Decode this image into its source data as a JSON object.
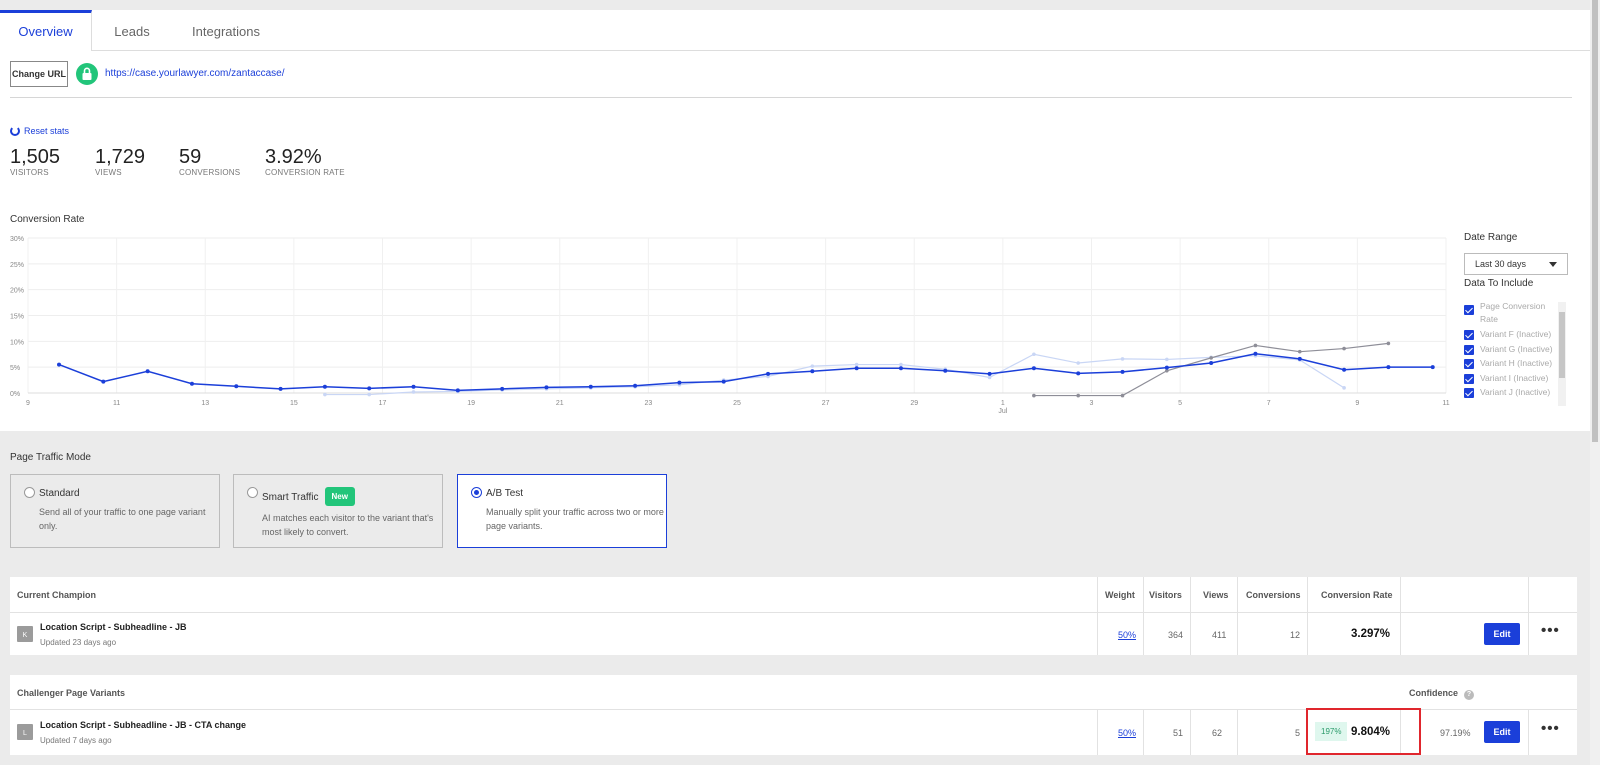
{
  "tabs": [
    {
      "label": "Overview",
      "active": true
    },
    {
      "label": "Leads",
      "active": false
    },
    {
      "label": "Integrations",
      "active": false
    }
  ],
  "url_bar": {
    "change_url_label": "Change URL",
    "url": "https://case.yourlawyer.com/zantaccase/",
    "lock_icon": "lock-icon"
  },
  "stats": {
    "reset_label": "Reset stats",
    "items": [
      {
        "value": "1,505",
        "label": "VISITORS"
      },
      {
        "value": "1,729",
        "label": "VIEWS"
      },
      {
        "value": "59",
        "label": "CONVERSIONS"
      },
      {
        "value": "3.92%",
        "label": "CONVERSION RATE"
      }
    ]
  },
  "conversion_rate_title": "Conversion Rate",
  "chart_data": {
    "type": "line",
    "title": "Conversion Rate",
    "x_ticks": [
      "9",
      "11",
      "13",
      "15",
      "17",
      "19",
      "21",
      "23",
      "25",
      "27",
      "29",
      "1",
      "3",
      "5",
      "7",
      "9",
      "11"
    ],
    "x_sublabel": {
      "tick": "1",
      "text": "Jul"
    },
    "y_ticks": [
      "30%",
      "25%",
      "20%",
      "15%",
      "10%",
      "5%",
      "0%"
    ],
    "ylim": [
      0,
      30
    ],
    "grid": true,
    "colors": {
      "main": "#1b3fd9",
      "light": "#c9d6f5",
      "gray": "#8e8e98",
      "mid": "#8c9bd6"
    },
    "series": [
      {
        "key": "main",
        "x": [
          9.7,
          10.7,
          11.7,
          12.7,
          13.7,
          14.7,
          15.7,
          16.7,
          17.7,
          18.7,
          19.7,
          20.7,
          21.7,
          22.7,
          23.7,
          24.7,
          25.7,
          26.7,
          27.7,
          28.7,
          29.7,
          30.7,
          31.7,
          32.7,
          33.7,
          34.7,
          35.7,
          36.7,
          37.7,
          38.7,
          39.7,
          40.7
        ],
        "values": [
          5.5,
          2.2,
          4.2,
          1.8,
          1.3,
          0.8,
          1.2,
          0.9,
          1.2,
          0.5,
          0.8,
          1.1,
          1.2,
          1.4,
          2.0,
          2.2,
          3.7,
          4.2,
          4.8,
          4.8,
          4.3,
          3.7,
          4.8,
          3.8,
          4.1,
          4.9,
          5.8,
          7.6,
          6.6,
          4.5,
          5.0,
          5.0
        ]
      },
      {
        "key": "light",
        "x": [
          15.7,
          16.7,
          17.7,
          18.7,
          19.7,
          20.7,
          21.7,
          22.7,
          23.7,
          24.7,
          25.7,
          26.7,
          27.7,
          28.7,
          29.7,
          30.7,
          31.7,
          32.7,
          33.7,
          34.7,
          35.7,
          36.7,
          37.7,
          38.7
        ],
        "values": [
          -0.3,
          -0.3,
          0.2,
          0.3,
          0.6,
          0.8,
          1.0,
          1.2,
          1.6,
          2.5,
          3.2,
          5.2,
          5.5,
          5.5,
          4.6,
          3.0,
          7.5,
          5.8,
          6.6,
          6.5,
          6.9,
          7.2,
          6.4,
          1.0
        ]
      },
      {
        "key": "gray",
        "x": [
          31.7,
          32.7,
          33.7,
          34.7,
          35.7,
          36.7,
          37.7,
          38.7,
          39.7
        ],
        "values": [
          -0.5,
          -0.5,
          -0.5,
          4.3,
          6.8,
          9.2,
          8.0,
          8.6,
          9.6
        ]
      }
    ]
  },
  "date_range": {
    "label": "Date Range",
    "value": "Last 30 days"
  },
  "data_to_include": {
    "label": "Data To Include",
    "items": [
      "Page Conversion Rate",
      "Variant F (Inactive)",
      "Variant G (Inactive)",
      "Variant H (Inactive)",
      "Variant I (Inactive)",
      "Variant J (Inactive)"
    ]
  },
  "traffic_mode": {
    "label": "Page Traffic Mode",
    "options": [
      {
        "title": "Standard",
        "desc": "Send all of your traffic to one page variant only.",
        "selected": false,
        "badge": ""
      },
      {
        "title": "Smart Traffic",
        "desc": "AI matches each visitor to the variant that's most likely to convert.",
        "selected": false,
        "badge": "New"
      },
      {
        "title": "A/B Test",
        "desc": "Manually split your traffic across two or more page variants.",
        "selected": true,
        "badge": ""
      }
    ]
  },
  "champion": {
    "header": "Current Champion",
    "columns": [
      "Weight",
      "Visitors",
      "Views",
      "Conversions",
      "Conversion Rate"
    ],
    "row": {
      "icon": "K",
      "name": "Location Script - Subheadline - JB",
      "updated": "Updated 23 days ago",
      "weight": "50%",
      "visitors": "364",
      "views": "411",
      "conversions": "12",
      "conversion_rate": "3.297%",
      "edit": "Edit",
      "more": "•••"
    }
  },
  "challengers": {
    "header": "Challenger Page Variants",
    "confidence_label": "Confidence",
    "row": {
      "icon": "L",
      "name": "Location Script - Subheadline - JB - CTA change",
      "updated": "Updated 7 days ago",
      "weight": "50%",
      "visitors": "51",
      "views": "62",
      "conversions": "5",
      "lift": "197%",
      "conversion_rate": "9.804%",
      "confidence": "97.19%",
      "edit": "Edit",
      "more": "•••"
    }
  }
}
